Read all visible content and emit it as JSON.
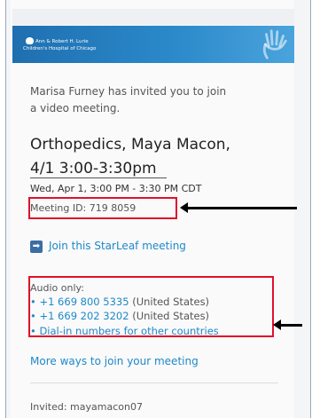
{
  "header": {
    "logo_line1": "Ann & Robert H. Lurie",
    "logo_line2": "Children's Hospital of Chicago"
  },
  "invite": {
    "line1": "Marisa Furney has invited you to join",
    "line2": "a video meeting."
  },
  "meeting": {
    "title_line1": "Orthopedics, Maya Macon,",
    "title_line2": "4/1 3:00-3:30pm",
    "when": "Wed, Apr 1, 3:00 PM - 3:30 PM CDT",
    "id_text": "Meeting ID: 719 8059"
  },
  "join": {
    "label": "Join this StarLeaf meeting"
  },
  "audio": {
    "label": "Audio only:",
    "items": [
      {
        "number": "+1 669 800 5335",
        "country": " (United States)"
      },
      {
        "number": "+1 669 202 3202",
        "country": " (United States)"
      },
      {
        "number": "Dial-in numbers for other countries",
        "country": ""
      }
    ]
  },
  "more": {
    "label": "More ways to join your meeting"
  },
  "footer": {
    "invited": "Invited: mayamacon07"
  },
  "colors": {
    "link": "#1e88c9",
    "highlight": "#e0102a",
    "banner": "#2a88c9"
  }
}
